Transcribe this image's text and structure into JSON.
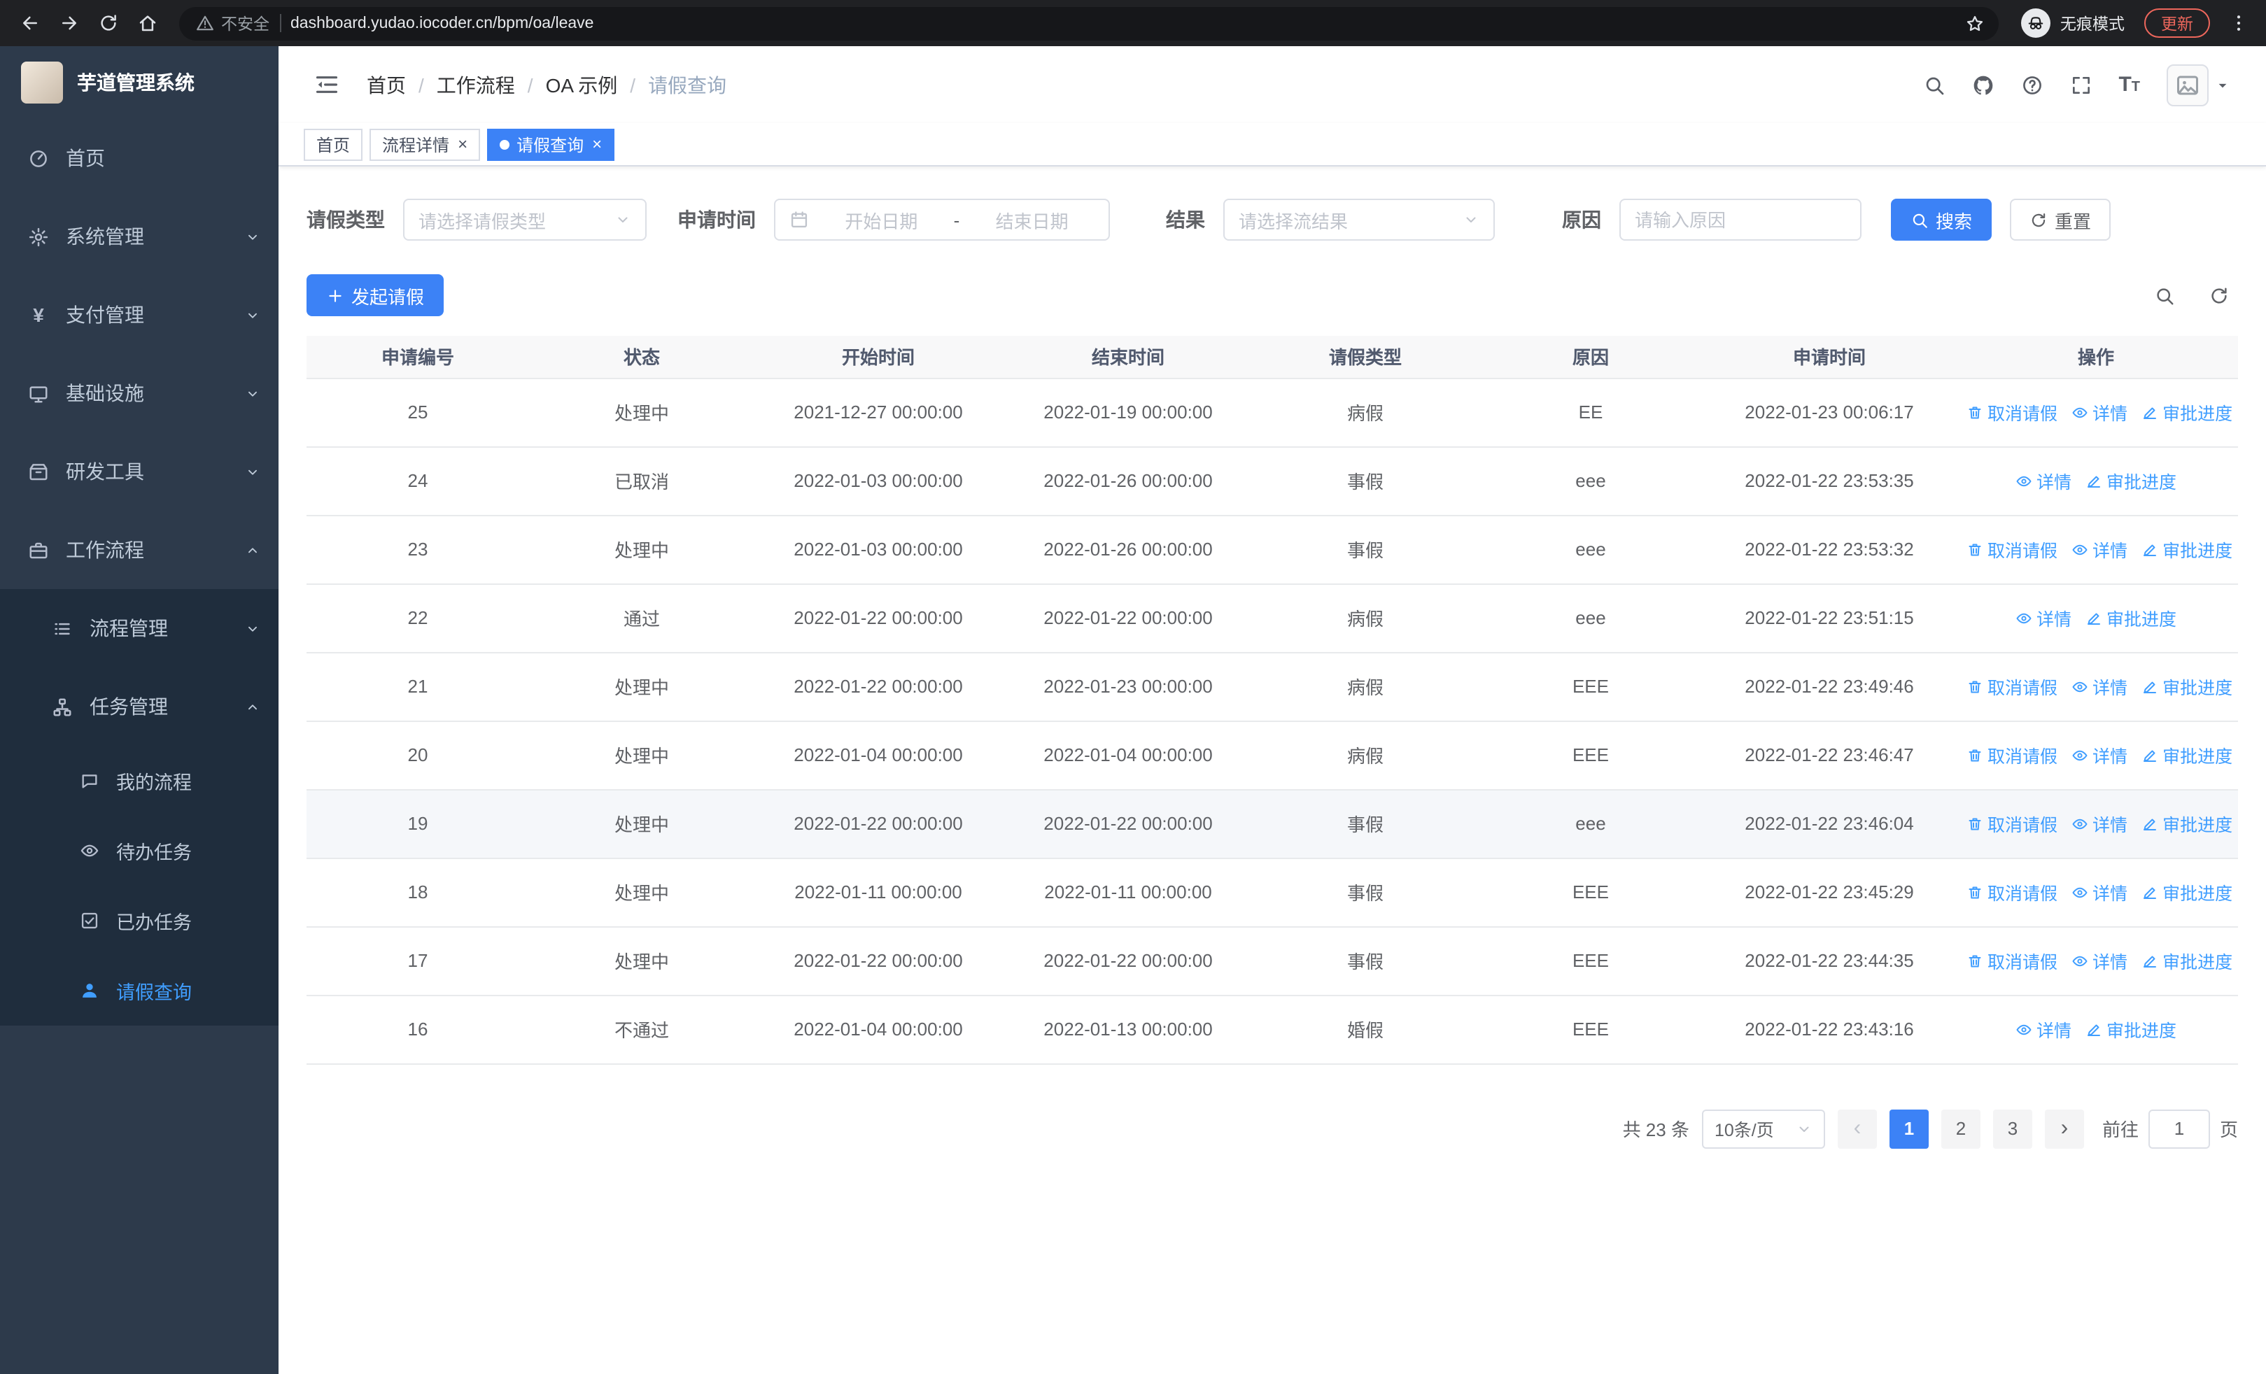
{
  "colors": {
    "accent": "#3c82f6",
    "link": "#409eff",
    "sidebar_bg": "#2d3a4b",
    "submenu_bg": "#1f2d3d",
    "update_warning": "#ee675c"
  },
  "glyphs": {
    "close": "×",
    "yen": "¥",
    "prev": "‹",
    "next": "›",
    "breadcrumb_separator": "/"
  },
  "browser": {
    "security_label": "不安全",
    "url": "dashboard.yudao.iocoder.cn/bpm/oa/leave",
    "incognito_label": "无痕模式",
    "update_label": "更新"
  },
  "sidebar": {
    "logo_title": "芋道管理系统",
    "menu": [
      {
        "name": "home",
        "label": "首页",
        "icon": "dashboard",
        "level": 0
      },
      {
        "name": "system-management",
        "label": "系统管理",
        "icon": "gear",
        "level": 0,
        "chevron": "down"
      },
      {
        "name": "payment-management",
        "label": "支付管理",
        "icon": "yen",
        "level": 0,
        "chevron": "down"
      },
      {
        "name": "infrastructure",
        "label": "基础设施",
        "icon": "monitor",
        "level": 0,
        "chevron": "down"
      },
      {
        "name": "dev-tools",
        "label": "研发工具",
        "icon": "toolbox",
        "level": 0,
        "chevron": "down"
      },
      {
        "name": "workflow",
        "label": "工作流程",
        "icon": "briefcase",
        "level": 0,
        "chevron": "up"
      },
      {
        "name": "process-management",
        "label": "流程管理",
        "icon": "list",
        "level": 1,
        "chevron": "down"
      },
      {
        "name": "task-management",
        "label": "任务管理",
        "icon": "nodes",
        "level": 1,
        "chevron": "up"
      },
      {
        "name": "my-process",
        "label": "我的流程",
        "icon": "chat",
        "level": 2
      },
      {
        "name": "todo-tasks",
        "label": "待办任务",
        "icon": "eye",
        "level": 2
      },
      {
        "name": "done-tasks",
        "label": "已办任务",
        "icon": "check-square",
        "level": 2
      },
      {
        "name": "leave-query",
        "label": "请假查询",
        "icon": "user",
        "level": 2,
        "active": true
      }
    ]
  },
  "navbar": {
    "breadcrumb": [
      "首页",
      "工作流程",
      "OA 示例",
      "请假查询"
    ],
    "font_size_icon": "T"
  },
  "tabs": [
    {
      "name": "home",
      "label": "首页",
      "closable": false,
      "active": false
    },
    {
      "name": "process-detail",
      "label": "流程详情",
      "closable": true,
      "active": false
    },
    {
      "name": "leave-query",
      "label": "请假查询",
      "closable": true,
      "active": true
    }
  ],
  "filters": {
    "leave_type_label": "请假类型",
    "leave_type_placeholder": "请选择请假类型",
    "apply_time_label": "申请时间",
    "start_date_placeholder": "开始日期",
    "range_separator": "-",
    "end_date_placeholder": "结束日期",
    "result_label": "结果",
    "result_placeholder": "请选择流结果",
    "reason_label": "原因",
    "reason_placeholder": "请输入原因",
    "search_button": "搜索",
    "reset_button": "重置"
  },
  "toolbar": {
    "create_button": "发起请假"
  },
  "table": {
    "headers": [
      "申请编号",
      "状态",
      "开始时间",
      "结束时间",
      "请假类型",
      "原因",
      "申请时间",
      "操作"
    ],
    "action_labels": {
      "cancel": "取消请假",
      "detail": "详情",
      "progress": "审批进度"
    },
    "rows": [
      {
        "id": "25",
        "status": "处理中",
        "start": "2021-12-27 00:00:00",
        "end": "2022-01-19 00:00:00",
        "type": "病假",
        "reason": "EE",
        "applied": "2022-01-23 00:06:17",
        "actions": [
          "cancel",
          "detail",
          "progress"
        ]
      },
      {
        "id": "24",
        "status": "已取消",
        "start": "2022-01-03 00:00:00",
        "end": "2022-01-26 00:00:00",
        "type": "事假",
        "reason": "eee",
        "applied": "2022-01-22 23:53:35",
        "actions": [
          "detail",
          "progress"
        ]
      },
      {
        "id": "23",
        "status": "处理中",
        "start": "2022-01-03 00:00:00",
        "end": "2022-01-26 00:00:00",
        "type": "事假",
        "reason": "eee",
        "applied": "2022-01-22 23:53:32",
        "actions": [
          "cancel",
          "detail",
          "progress"
        ]
      },
      {
        "id": "22",
        "status": "通过",
        "start": "2022-01-22 00:00:00",
        "end": "2022-01-22 00:00:00",
        "type": "病假",
        "reason": "eee",
        "applied": "2022-01-22 23:51:15",
        "actions": [
          "detail",
          "progress"
        ]
      },
      {
        "id": "21",
        "status": "处理中",
        "start": "2022-01-22 00:00:00",
        "end": "2022-01-23 00:00:00",
        "type": "病假",
        "reason": "EEE",
        "applied": "2022-01-22 23:49:46",
        "actions": [
          "cancel",
          "detail",
          "progress"
        ]
      },
      {
        "id": "20",
        "status": "处理中",
        "start": "2022-01-04 00:00:00",
        "end": "2022-01-04 00:00:00",
        "type": "病假",
        "reason": "EEE",
        "applied": "2022-01-22 23:46:47",
        "actions": [
          "cancel",
          "detail",
          "progress"
        ]
      },
      {
        "id": "19",
        "status": "处理中",
        "start": "2022-01-22 00:00:00",
        "end": "2022-01-22 00:00:00",
        "type": "事假",
        "reason": "eee",
        "applied": "2022-01-22 23:46:04",
        "actions": [
          "cancel",
          "detail",
          "progress"
        ],
        "hover": true
      },
      {
        "id": "18",
        "status": "处理中",
        "start": "2022-01-11 00:00:00",
        "end": "2022-01-11 00:00:00",
        "type": "事假",
        "reason": "EEE",
        "applied": "2022-01-22 23:45:29",
        "actions": [
          "cancel",
          "detail",
          "progress"
        ]
      },
      {
        "id": "17",
        "status": "处理中",
        "start": "2022-01-22 00:00:00",
        "end": "2022-01-22 00:00:00",
        "type": "事假",
        "reason": "EEE",
        "applied": "2022-01-22 23:44:35",
        "actions": [
          "cancel",
          "detail",
          "progress"
        ]
      },
      {
        "id": "16",
        "status": "不通过",
        "start": "2022-01-04 00:00:00",
        "end": "2022-01-13 00:00:00",
        "type": "婚假",
        "reason": "EEE",
        "applied": "2022-01-22 23:43:16",
        "actions": [
          "detail",
          "progress"
        ]
      }
    ]
  },
  "pagination": {
    "total_text": "共 23 条",
    "page_size_label": "10条/页",
    "pages": [
      "1",
      "2",
      "3"
    ],
    "active_page": "1",
    "goto_label": "前往",
    "goto_value": "1",
    "goto_suffix": "页"
  }
}
